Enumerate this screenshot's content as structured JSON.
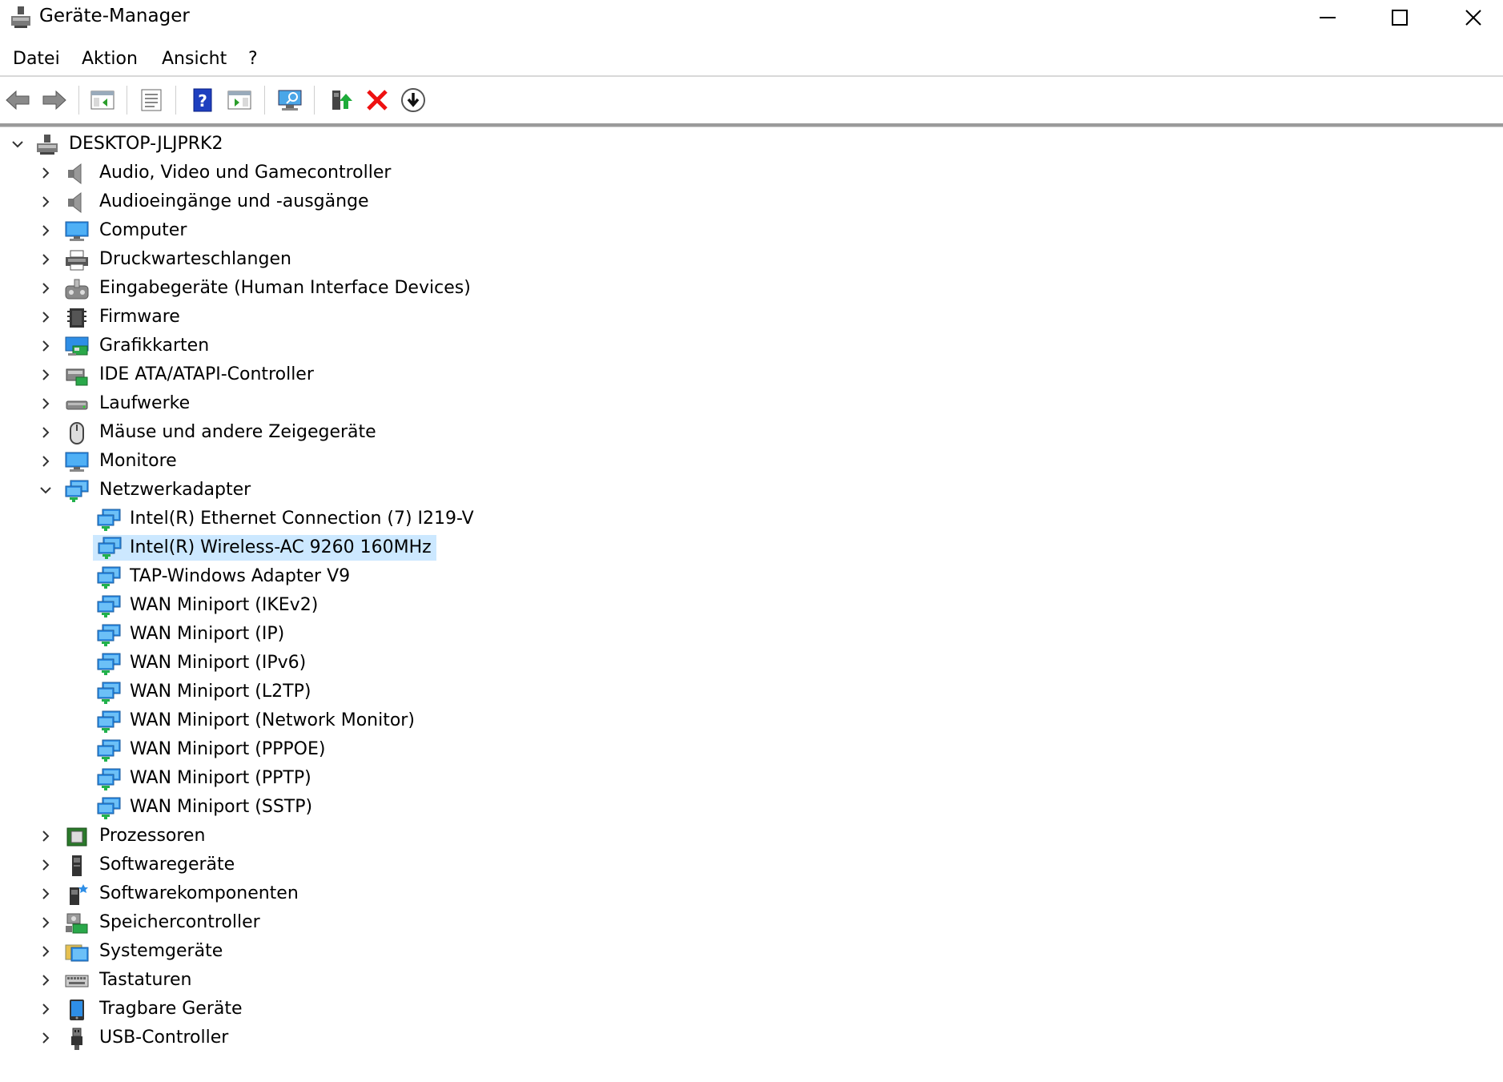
{
  "window": {
    "title": "Geräte-Manager"
  },
  "menu": [
    "Datei",
    "Aktion",
    "Ansicht",
    "?"
  ],
  "toolbar": {
    "buttons": [
      {
        "name": "back-button",
        "icon": "arrow-left-icon"
      },
      {
        "name": "forward-button",
        "icon": "arrow-right-icon"
      },
      {
        "name": "show-hide-console-tree-button",
        "icon": "console-tree-icon"
      },
      {
        "name": "properties-button",
        "icon": "properties-icon"
      },
      {
        "name": "help-button",
        "icon": "help-icon"
      },
      {
        "name": "show-action-pane-button",
        "icon": "action-pane-icon"
      },
      {
        "name": "scan-hardware-button",
        "icon": "scan-monitor-icon"
      },
      {
        "name": "update-driver-button",
        "icon": "update-driver-icon"
      },
      {
        "name": "uninstall-device-button",
        "icon": "red-x-icon"
      },
      {
        "name": "disable-device-button",
        "icon": "down-arrow-circle-icon"
      }
    ]
  },
  "tree": {
    "root": "DESKTOP-JLJPRK2",
    "categories": [
      {
        "label": "Audio, Video und Gamecontroller",
        "icon": "speaker-icon",
        "expanded": false
      },
      {
        "label": "Audioeingänge und -ausgänge",
        "icon": "speaker-icon",
        "expanded": false
      },
      {
        "label": "Computer",
        "icon": "computer-icon",
        "expanded": false
      },
      {
        "label": "Druckwarteschlangen",
        "icon": "printer-icon",
        "expanded": false
      },
      {
        "label": "Eingabegeräte (Human Interface Devices)",
        "icon": "hid-icon",
        "expanded": false
      },
      {
        "label": "Firmware",
        "icon": "chip-icon",
        "expanded": false
      },
      {
        "label": "Grafikkarten",
        "icon": "display-adapter-icon",
        "expanded": false
      },
      {
        "label": "IDE ATA/ATAPI-Controller",
        "icon": "ide-controller-icon",
        "expanded": false
      },
      {
        "label": "Laufwerke",
        "icon": "drive-icon",
        "expanded": false
      },
      {
        "label": "Mäuse und andere Zeigegeräte",
        "icon": "mouse-icon",
        "expanded": false
      },
      {
        "label": "Monitore",
        "icon": "monitor-icon",
        "expanded": false
      },
      {
        "label": "Netzwerkadapter",
        "icon": "network-adapter-icon",
        "expanded": true,
        "children": [
          {
            "label": "Intel(R) Ethernet Connection (7) I219-V",
            "selected": false
          },
          {
            "label": "Intel(R) Wireless-AC 9260 160MHz",
            "selected": true
          },
          {
            "label": "TAP-Windows Adapter V9",
            "selected": false
          },
          {
            "label": "WAN Miniport (IKEv2)",
            "selected": false
          },
          {
            "label": "WAN Miniport (IP)",
            "selected": false
          },
          {
            "label": "WAN Miniport (IPv6)",
            "selected": false
          },
          {
            "label": "WAN Miniport (L2TP)",
            "selected": false
          },
          {
            "label": "WAN Miniport (Network Monitor)",
            "selected": false
          },
          {
            "label": "WAN Miniport (PPPOE)",
            "selected": false
          },
          {
            "label": "WAN Miniport (PPTP)",
            "selected": false
          },
          {
            "label": "WAN Miniport (SSTP)",
            "selected": false
          }
        ]
      },
      {
        "label": "Prozessoren",
        "icon": "processor-icon",
        "expanded": false
      },
      {
        "label": "Softwaregeräte",
        "icon": "software-device-icon",
        "expanded": false
      },
      {
        "label": "Softwarekomponenten",
        "icon": "software-component-icon",
        "expanded": false
      },
      {
        "label": "Speichercontroller",
        "icon": "storage-controller-icon",
        "expanded": false
      },
      {
        "label": "Systemgeräte",
        "icon": "system-device-icon",
        "expanded": false
      },
      {
        "label": "Tastaturen",
        "icon": "keyboard-icon",
        "expanded": false
      },
      {
        "label": "Tragbare Geräte",
        "icon": "portable-device-icon",
        "expanded": false
      },
      {
        "label": "USB-Controller",
        "icon": "usb-icon",
        "expanded": false
      }
    ]
  },
  "colors": {
    "selection": "#cce8ff",
    "accent_blue": "#1e90e6",
    "network_green": "#22b14c"
  }
}
